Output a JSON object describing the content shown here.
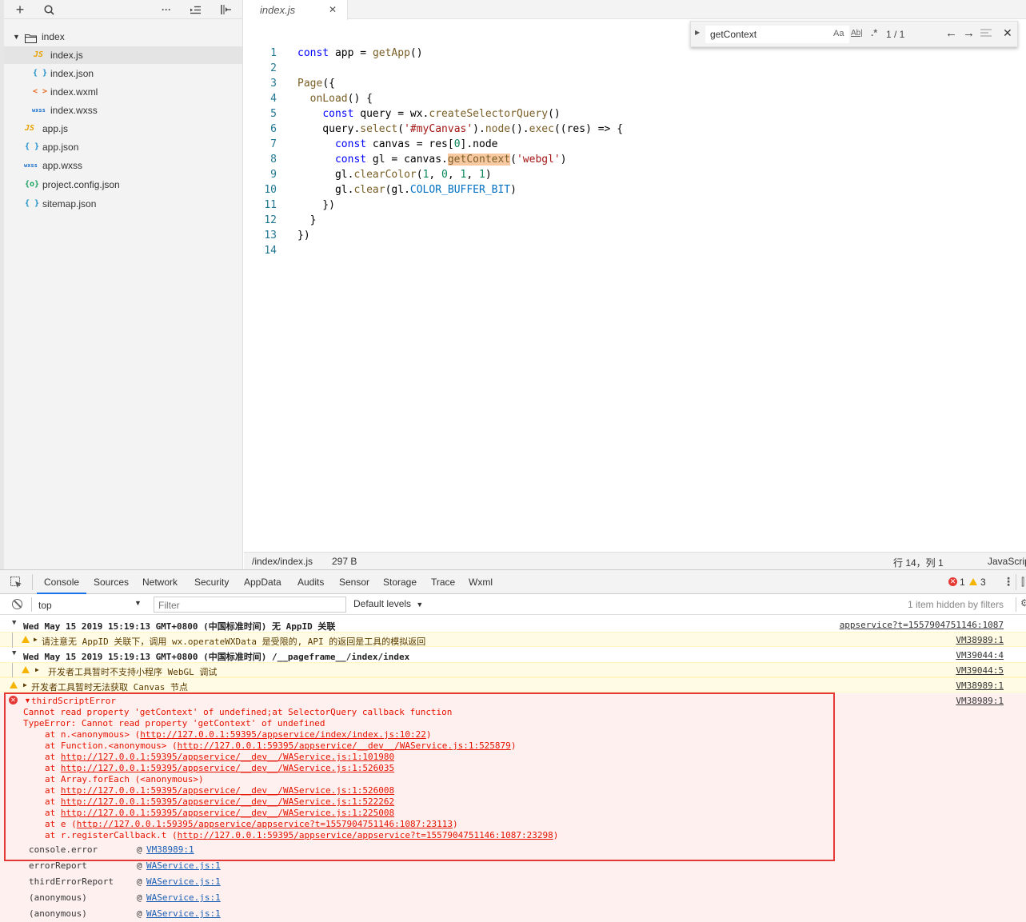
{
  "sidebar": {
    "toolbar": {
      "add": "+",
      "search": "⌕",
      "more": "···",
      "outdent": "⇤",
      "collapse": "⇤"
    },
    "tree": [
      {
        "label": "index",
        "icon": "folder-icon",
        "type": "folder"
      },
      {
        "label": "index.js",
        "icon": "JS",
        "type": "js"
      },
      {
        "label": "index.json",
        "icon": "{ }",
        "type": "json"
      },
      {
        "label": "index.wxml",
        "icon": "< >",
        "type": "wxml"
      },
      {
        "label": "index.wxss",
        "icon": "wxss",
        "type": "wxss"
      },
      {
        "label": "app.js",
        "icon": "JS",
        "type": "js"
      },
      {
        "label": "app.json",
        "icon": "{ }",
        "type": "json"
      },
      {
        "label": "app.wxss",
        "icon": "wxss",
        "type": "wxss"
      },
      {
        "label": "project.config.json",
        "icon": "{o}",
        "type": "config"
      },
      {
        "label": "sitemap.json",
        "icon": "{ }",
        "type": "json"
      }
    ]
  },
  "editor": {
    "tab_label": "index.js",
    "tab_close": "✕",
    "find": {
      "query": "getContext",
      "case": "Aa",
      "word": "Ab|",
      "regex": ".*",
      "count": "1 / 1"
    },
    "line_numbers": [
      "1",
      "2",
      "3",
      "4",
      "5",
      "6",
      "7",
      "8",
      "9",
      "10",
      "11",
      "12",
      "13",
      "14"
    ]
  },
  "statusbar": {
    "path": "/index/index.js",
    "size": "297 B",
    "position": "行 14，列 1",
    "lang": "JavaScript"
  },
  "devtools": {
    "tabs": [
      "Console",
      "Sources",
      "Network",
      "Security",
      "AppData",
      "Audits",
      "Sensor",
      "Storage",
      "Trace",
      "Wxml"
    ],
    "error_count": "1",
    "warn_count": "3",
    "context": "top",
    "filter_placeholder": "Filter",
    "levels": "Default levels",
    "hidden": "1 item hidden by filters"
  },
  "console": {
    "g1_header": "Wed May 15 2019 15:19:13 GMT+0800 (中国标准时间) 无 AppID 关联",
    "g1_src": "appservice?t=1557904751146:1087",
    "w1": "请注意无 AppID 关联下，调用 wx.operateWXData 是受限的, API 的返回是工具的模拟返回",
    "w1_src": "VM38989:1",
    "g2_header": "Wed May 15 2019 15:19:13 GMT+0800 (中国标准时间) /__pageframe__/index/index",
    "g2_src": "VM39044:4",
    "w2": "开发者工具暂时不支持小程序 WebGL 调试",
    "w2_src": "VM39044:5",
    "w3": "开发者工具暂时无法获取 Canvas 节点",
    "w3_src": "VM38989:1",
    "e_title": "thirdScriptError",
    "e_src": "VM38989:1",
    "e_msg1": "Cannot read property 'getContext' of undefined;at SelectorQuery callback function",
    "e_msg2": "TypeError: Cannot read property 'getContext' of undefined",
    "stack": [
      {
        "pre": "at n.<anonymous> (",
        "url": "http://127.0.0.1:59395/appservice/index/index.js:10:22",
        "post": ")"
      },
      {
        "pre": "at Function.<anonymous> (",
        "url": "http://127.0.0.1:59395/appservice/__dev__/WAService.js:1:525879",
        "post": ")"
      },
      {
        "pre": "at ",
        "url": "http://127.0.0.1:59395/appservice/__dev__/WAService.js:1:101980",
        "post": ""
      },
      {
        "pre": "at ",
        "url": "http://127.0.0.1:59395/appservice/__dev__/WAService.js:1:526035",
        "post": ""
      },
      {
        "pre": "at Array.forEach (<anonymous>)",
        "url": "",
        "post": ""
      },
      {
        "pre": "at ",
        "url": "http://127.0.0.1:59395/appservice/__dev__/WAService.js:1:526008",
        "post": ""
      },
      {
        "pre": "at ",
        "url": "http://127.0.0.1:59395/appservice/__dev__/WAService.js:1:522262",
        "post": ""
      },
      {
        "pre": "at ",
        "url": "http://127.0.0.1:59395/appservice/__dev__/WAService.js:1:225008",
        "post": ""
      },
      {
        "pre": "at e (",
        "url": "http://127.0.0.1:59395/appservice/appservice?t=1557904751146:1087:23113",
        "post": ")"
      },
      {
        "pre": "at r.registerCallback.t (",
        "url": "http://127.0.0.1:59395/appservice/appservice?t=1557904751146:1087:23298",
        "post": ")"
      }
    ],
    "calls": [
      {
        "fn": "console.error",
        "src": "VM38989:1"
      },
      {
        "fn": "errorReport",
        "src": "WAService.js:1"
      },
      {
        "fn": "thirdErrorReport",
        "src": "WAService.js:1"
      },
      {
        "fn": "(anonymous)",
        "src": "WAService.js:1"
      },
      {
        "fn": "(anonymous)",
        "src": "WAService.js:1"
      }
    ]
  }
}
